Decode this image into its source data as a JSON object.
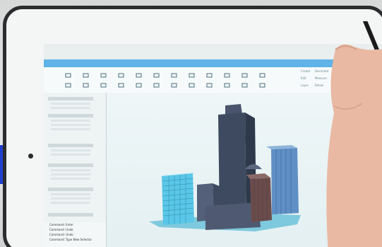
{
  "sidepanel": {
    "title": ""
  },
  "command_line": {
    "lines": [
      "Command: Enter",
      "Command: Undo",
      "Command: Undo",
      "Command: Type New Selector"
    ]
  },
  "right_panel": {
    "labels": [
      "Create",
      "Decorator",
      "Edit",
      "Measure",
      "Layer",
      "Below"
    ]
  },
  "ribbon": {
    "icons": [
      "refresh-icon",
      "move-icon",
      "menu-icon",
      "copy-icon",
      "bars-icon",
      "rect-icon",
      "cylinder-icon",
      "triangle-icon",
      "panel-icon",
      "window-icon",
      "pen-icon",
      "info-icon",
      "circle-icon",
      "door-icon",
      "align-icon",
      "globe-icon",
      "grid-icon",
      "search-icon",
      "note-icon",
      "doc-icon",
      "box-icon",
      "pause-icon",
      "fold-icon",
      "settings-icon"
    ]
  },
  "colors": {
    "ribbon_blue": "#5fb3e6",
    "tower_dark": "#3d4a60",
    "building_cyan": "#5ac7e8",
    "ground": "#7ec9dd"
  }
}
